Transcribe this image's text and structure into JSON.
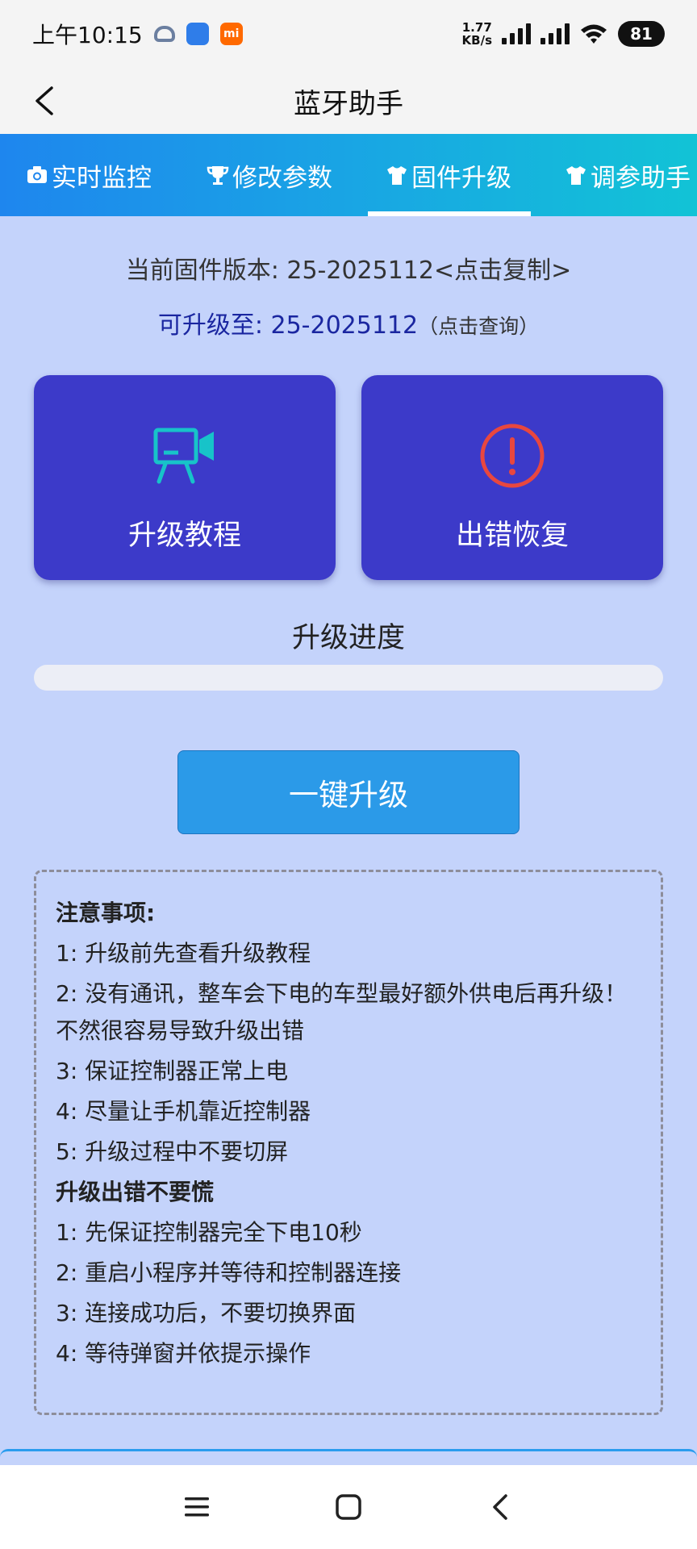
{
  "status_bar": {
    "time": "上午10:15",
    "net_speed_value": "1.77",
    "net_speed_unit": "KB/s",
    "battery": "81"
  },
  "title_bar": {
    "title": "蓝牙助手"
  },
  "tabs": [
    {
      "label": "实时监控",
      "icon": "camera-icon"
    },
    {
      "label": "修改参数",
      "icon": "trophy-icon"
    },
    {
      "label": "固件升级",
      "icon": "shirt-icon",
      "active": true
    },
    {
      "label": "调参助手",
      "icon": "shirt-icon"
    }
  ],
  "firmware": {
    "current_version": "当前固件版本: 25-2025112<点击复制>",
    "upgrade_to": "可升级至: 25-2025112",
    "query_hint": "（点击查询）"
  },
  "cards": {
    "tutorial_label": "升级教程",
    "recovery_label": "出错恢复"
  },
  "progress": {
    "label": "升级进度",
    "percent": 0
  },
  "upgrade_button": {
    "label": "一键升级"
  },
  "notes": {
    "heading1": "注意事项:",
    "items1": [
      "1:  升级前先查看升级教程",
      "2:  没有通讯，整车会下电的车型最好额外供电后再升级！不然很容易导致升级出错",
      "3:  保证控制器正常上电",
      "4:  尽量让手机靠近控制器",
      "5:  升级过程中不要切屏"
    ],
    "heading2": "升级出错不要慌",
    "items2": [
      "1:  先保证控制器完全下电10秒",
      "2:  重启小程序并等待和控制器连接",
      "3:  连接成功后，不要切换界面",
      "4:  等待弹窗并依提示操作"
    ]
  },
  "colors": {
    "background": "#c4d3fb",
    "card": "#3c3ac9",
    "accent": "#2b9ae8",
    "upgrade_text": "#1a26a0",
    "warning": "#e8473f",
    "tutorial_icon": "#17c3c9"
  }
}
